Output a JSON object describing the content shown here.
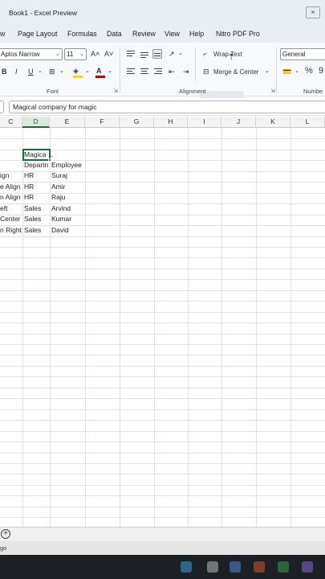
{
  "window": {
    "title": "Book1 - Excel Preview",
    "close_label": "×"
  },
  "menu": [
    "w",
    "Page Layout",
    "Formulas",
    "Data",
    "Review",
    "View",
    "Help",
    "Nitro PDF Pro"
  ],
  "ribbon": {
    "font_name": "Aptos Narrow",
    "font_size": "11",
    "grow_font": "A˄",
    "shrink_font": "A˅",
    "bold": "B",
    "italic": "I",
    "underline": "U",
    "wrap_text": "Wrap Text",
    "merge_center": "Merge & Center",
    "number_format": "General",
    "percent": "%",
    "comma": "9",
    "groups": {
      "font": "Font",
      "alignment": "Alignment",
      "number": "Numbe"
    }
  },
  "formula_bar": {
    "content": "Magical company for magic"
  },
  "grid": {
    "columns": [
      "C",
      "D",
      "E",
      "F",
      "G",
      "H",
      "I",
      "J",
      "K",
      "L"
    ],
    "active_column": "D",
    "cells": {
      "d_title": "Magica",
      "e_overflow": "..",
      "d_header": "Departn",
      "e_header": "Employee",
      "c": [
        "ign",
        "e Align",
        "n Align",
        "eft",
        "Center",
        "n Right"
      ],
      "d": [
        "HR",
        "HR",
        "HR",
        "Sales",
        "Sales",
        "Sales"
      ],
      "e": [
        "Suraj",
        "Amir",
        "Raju",
        "Arvind",
        "Kumar",
        "David"
      ]
    }
  },
  "status": {
    "text": "go"
  },
  "colors": {
    "accent": "#1d6b3a",
    "ribbon_bg": "#f7f9fc",
    "title_bg": "#e9eef5",
    "font_color_red": "#c00000",
    "highlight_yellow": "#ffd500"
  },
  "icons": [
    "close-icon",
    "dropdown-icon",
    "align-top-icon",
    "align-middle-icon",
    "align-bottom-icon",
    "orientation-icon",
    "align-left-icon",
    "align-center-icon",
    "align-right-icon",
    "decrease-indent-icon",
    "increase-indent-icon",
    "wrap-text-icon",
    "merge-center-icon",
    "border-icon",
    "fill-color-icon",
    "font-color-icon",
    "currency-icon",
    "dialog-launcher-icon",
    "add-sheet-icon",
    "cursor-icon"
  ]
}
